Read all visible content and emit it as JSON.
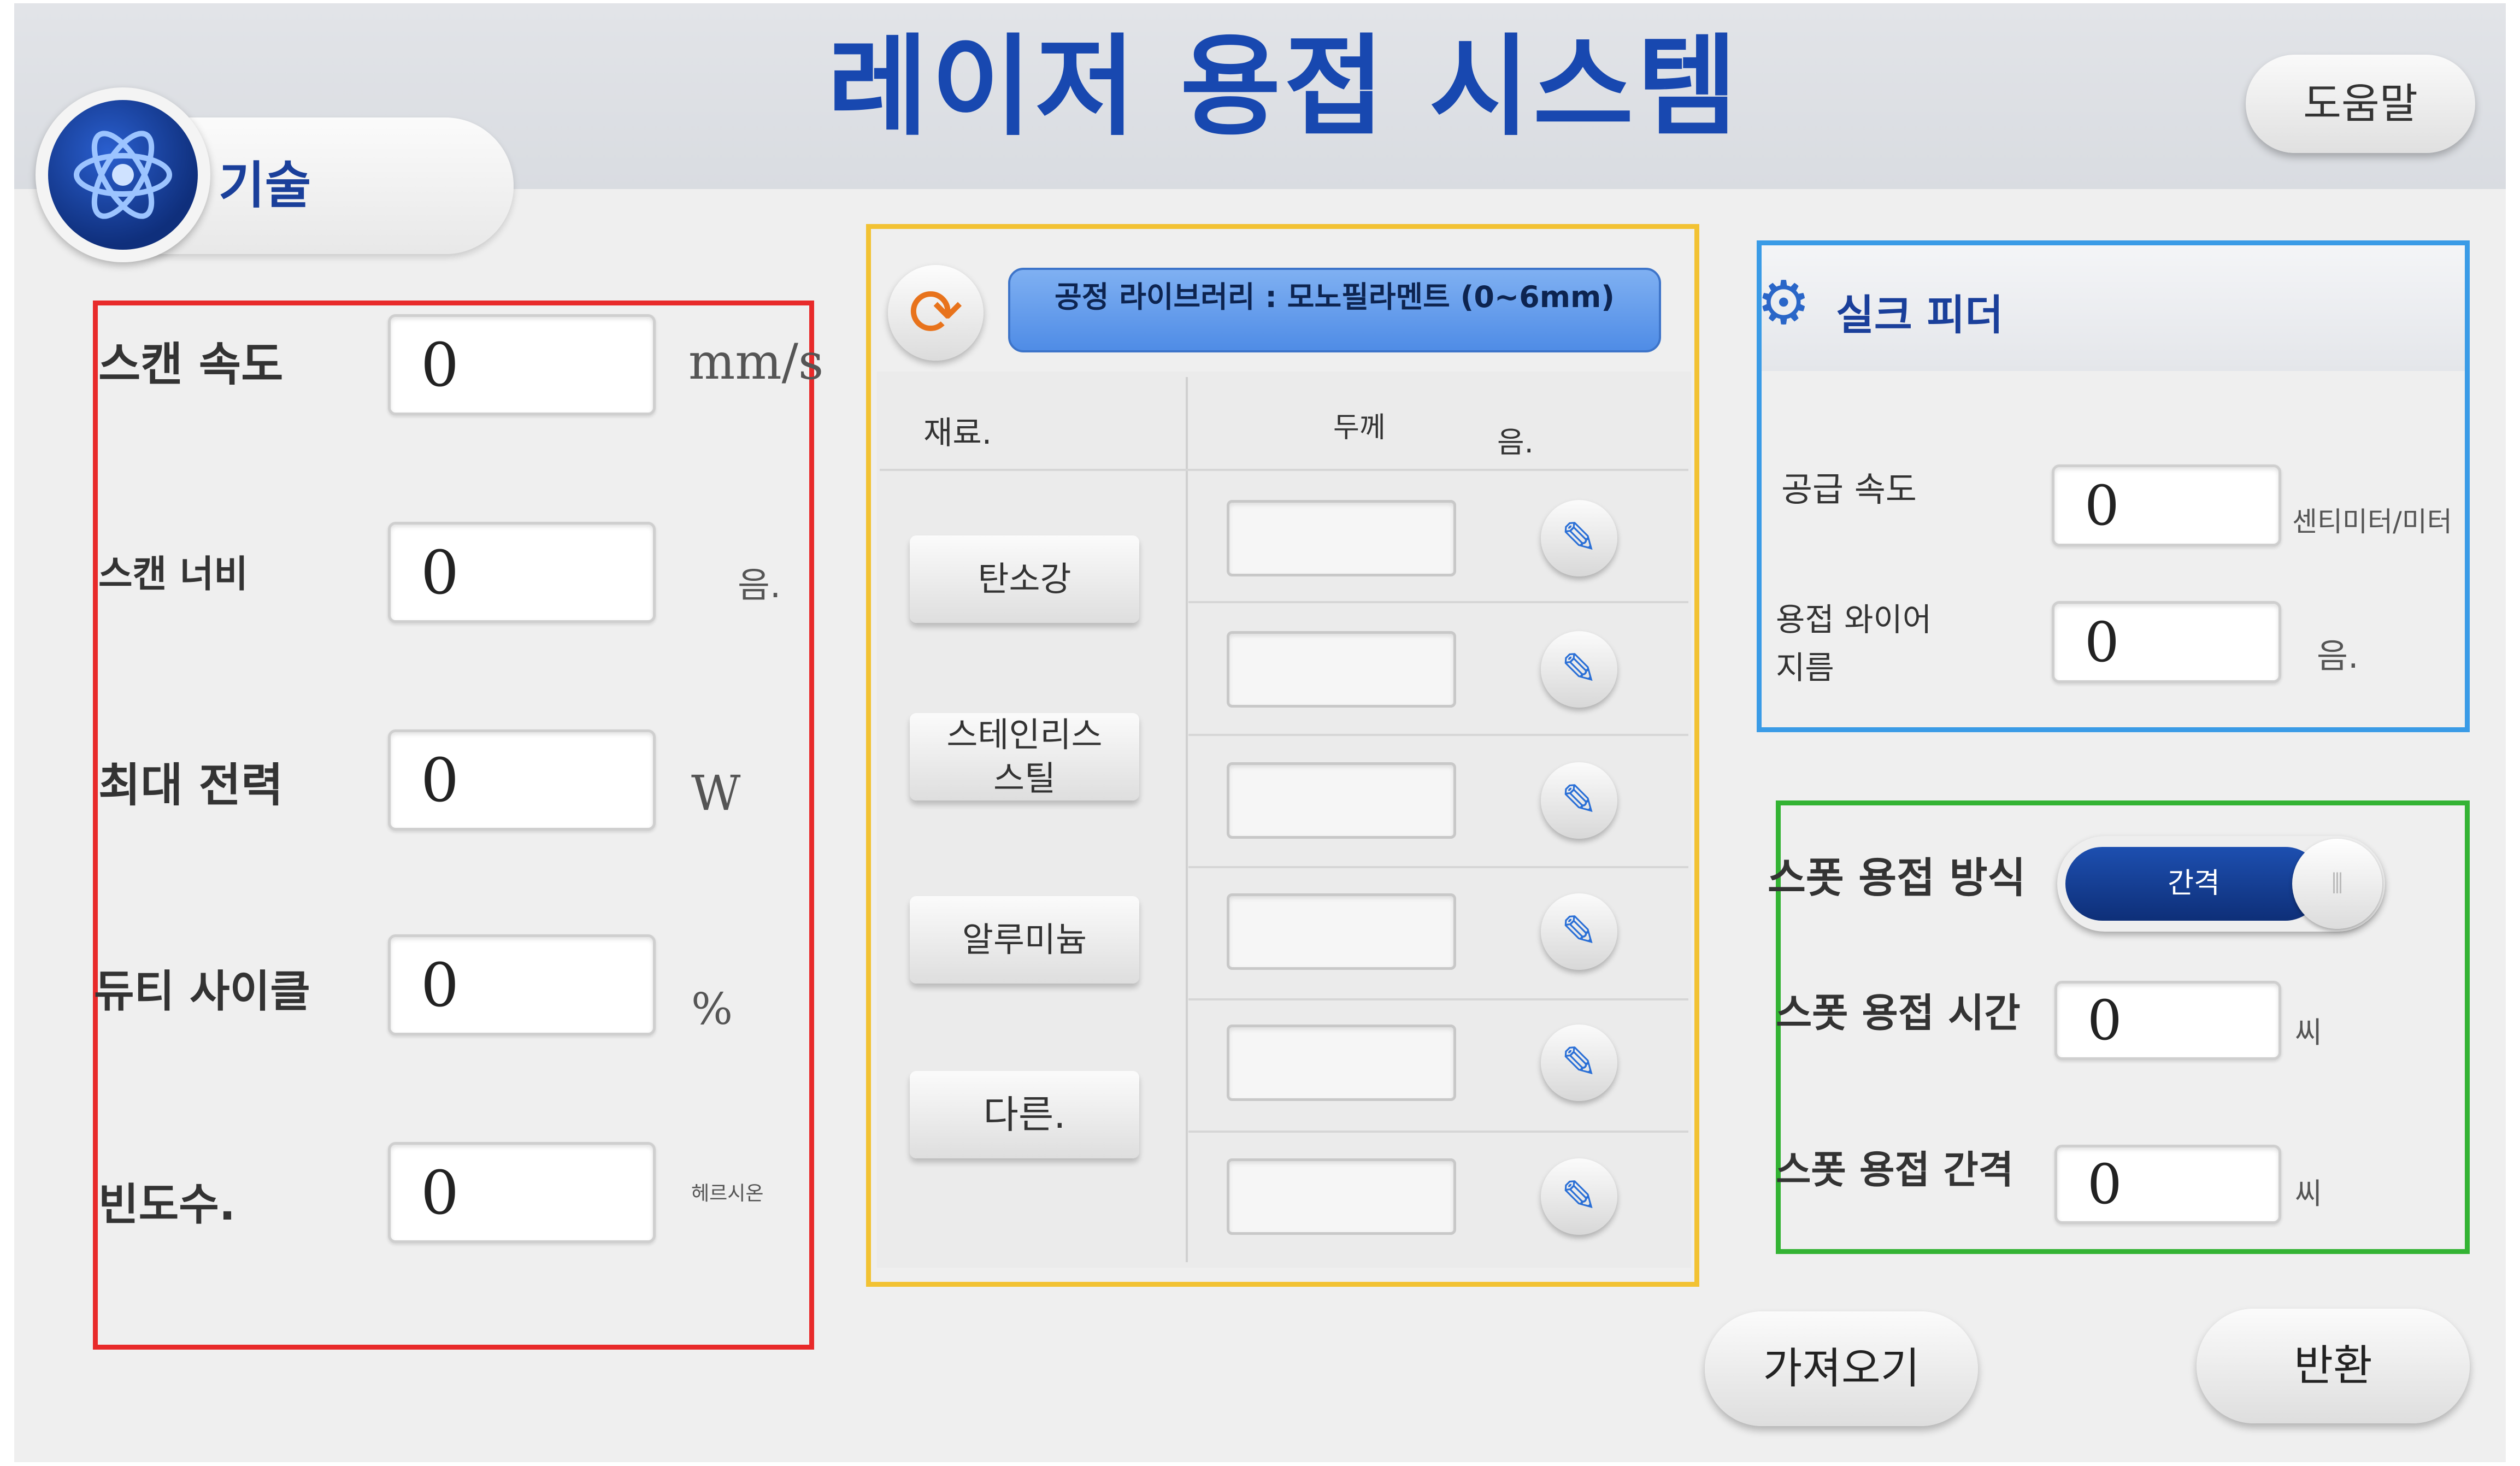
{
  "header": {
    "title": "레이저 용접 시스템",
    "help_label": "도움말"
  },
  "tech": {
    "label": "기술",
    "icon": "atom-icon"
  },
  "laser_params": {
    "rows": [
      {
        "label": "스캔 속도",
        "value": "0",
        "unit": "mm/s"
      },
      {
        "label": "스캔 너비",
        "value": "0",
        "unit": "음."
      },
      {
        "label": "최대 전력",
        "value": "0",
        "unit": "W"
      },
      {
        "label": "듀티 사이클",
        "value": "0",
        "unit": "%"
      },
      {
        "label": "빈도수.",
        "value": "0",
        "unit": "헤르시온"
      }
    ]
  },
  "library": {
    "title": "공정 라이브러리 : 모노필라멘트 (0~6mm)",
    "col_material": "재료.",
    "col_thickness": "두께",
    "col_unit": "음.",
    "materials": [
      "탄소강",
      "스테인리스\n스틸",
      "알루미늄",
      "다른."
    ]
  },
  "wire_feeder": {
    "title": "실크 피더",
    "feed_speed_label": "공급 속도",
    "feed_speed_value": "0",
    "feed_speed_unit": "센티미터/미터",
    "wire_dia_label": "용접 와이어\n지름",
    "wire_dia_value": "0",
    "wire_dia_unit": "음."
  },
  "spot": {
    "mode_label": "스폿 용접 방식",
    "mode_value": "간격",
    "time_label": "스폿 용접 시간",
    "time_value": "0",
    "time_unit": "씨",
    "interval_label": "스폿 용접 간격",
    "interval_value": "0",
    "interval_unit": "씨"
  },
  "footer": {
    "import_label": "가져오기",
    "return_label": "반환"
  },
  "colors": {
    "title": "#1848b0",
    "red_box": "#e82a2a",
    "yellow_box": "#f2c233",
    "blue_box": "#3a9be6",
    "green_box": "#33b333"
  }
}
